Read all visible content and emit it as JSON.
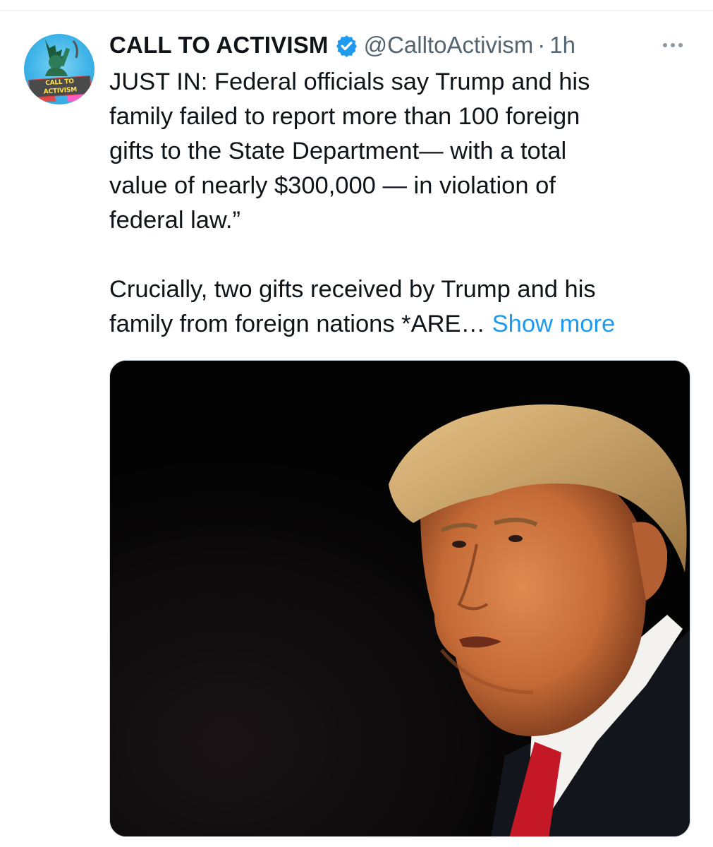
{
  "tweet": {
    "display_name": "CALL TO ACTIVISM",
    "handle": "@CalltoActivism",
    "separator": "·",
    "time": "1h",
    "avatar_text": "CALL TO ACTIVISM",
    "paragraph_1": "JUST IN: Federal officials say Trump and his\nfamily failed to report more than 100 foreign\ngifts to the State Department— with a total\nvalue of nearly $300,000 — in violation of\nfederal law.”",
    "paragraph_2": "Crucially, two gifts received by Trump and his\nfamily from foreign nations *ARE…",
    "show_more": "Show more"
  },
  "icons": {
    "verified": "verified-badge-icon",
    "more": "more-options-icon"
  },
  "colors": {
    "link": "#1d9bf0",
    "verified": "#1d9bf0",
    "secondary_text": "#536471",
    "primary_text": "#0f1419"
  }
}
